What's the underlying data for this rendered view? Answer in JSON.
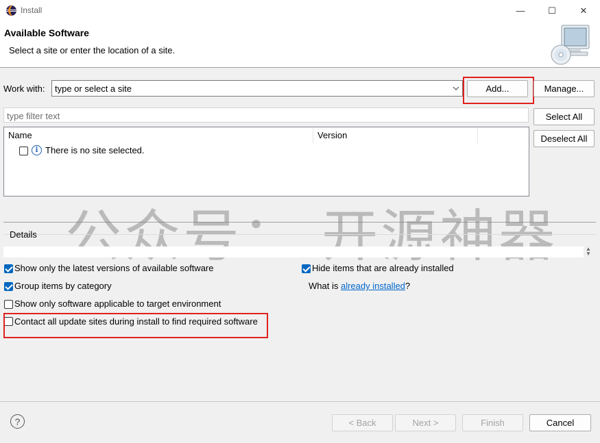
{
  "window": {
    "title": "Install",
    "minimize_glyph": "—",
    "maximize_glyph": "☐",
    "close_glyph": "✕"
  },
  "header": {
    "title": "Available Software",
    "description": "Select a site or enter the location of a site.",
    "icon": "cd-monitor-icon"
  },
  "work_with": {
    "label": "Work with:",
    "value": "type or select a site",
    "add_label": "Add...",
    "manage_label": "Manage..."
  },
  "filter": {
    "placeholder": "type filter text"
  },
  "select_all_label": "Select All",
  "deselect_all_label": "Deselect All",
  "table": {
    "columns": [
      "Name",
      "Version"
    ],
    "rows": [
      {
        "name": "There is no site selected.",
        "checked": false,
        "icon": "info-icon"
      }
    ]
  },
  "watermark": "公众号：  开源神器",
  "details": {
    "label": "Details",
    "value": ""
  },
  "options": {
    "latest_versions": {
      "label": "Show only the latest versions of available software",
      "checked": true
    },
    "group_by_category": {
      "label": "Group items by category",
      "checked": true
    },
    "target_env": {
      "label": "Show only software applicable to target environment",
      "checked": false
    },
    "contact_all_sites": {
      "label": "Contact all update sites during install to find required software",
      "checked": false
    },
    "hide_installed": {
      "label": "Hide items that are already installed",
      "checked": true
    }
  },
  "what_is": {
    "prefix": "What is ",
    "link": "already installed",
    "suffix": "?"
  },
  "footer": {
    "help_glyph": "?",
    "back_label": "< Back",
    "next_label": "Next >",
    "finish_label": "Finish",
    "cancel_label": "Cancel"
  },
  "colors": {
    "highlight": "#e0201e",
    "checkbox_checked": "#0067c0",
    "link": "#0066cc"
  }
}
